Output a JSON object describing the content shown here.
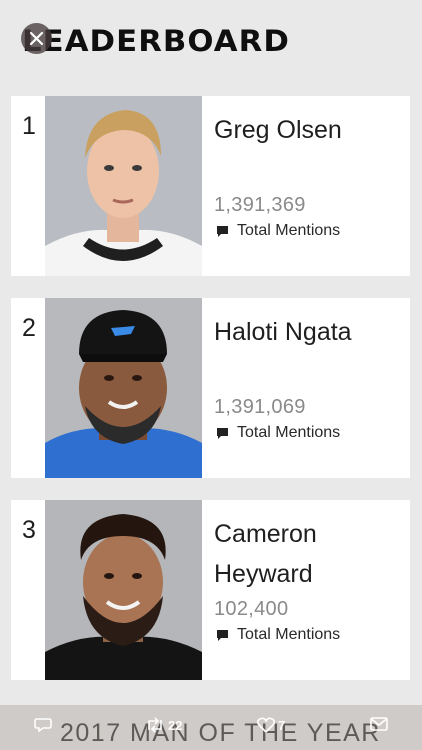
{
  "header": {
    "title": "LEADERBOARD",
    "close_icon": "close-icon"
  },
  "leaderboard": [
    {
      "rank": "1",
      "name": "Greg Olsen",
      "count": "1,391,369",
      "metric_label": "Total Mentions",
      "jersey_color": "#ffffff"
    },
    {
      "rank": "2",
      "name": "Haloti Ngata",
      "count": "1,391,069",
      "metric_label": "Total Mentions",
      "jersey_color": "#2e6fd0"
    },
    {
      "rank": "3",
      "name": "Cameron Heyward",
      "count": "102,400",
      "metric_label": "Total Mentions",
      "jersey_color": "#141414"
    }
  ],
  "tweet_bar": {
    "banner_text": "2017 MAN OF THE YEAR",
    "reply_icon": "reply-icon",
    "retweet_count": "22",
    "like_count": "7",
    "mail_icon": "mail-icon"
  }
}
